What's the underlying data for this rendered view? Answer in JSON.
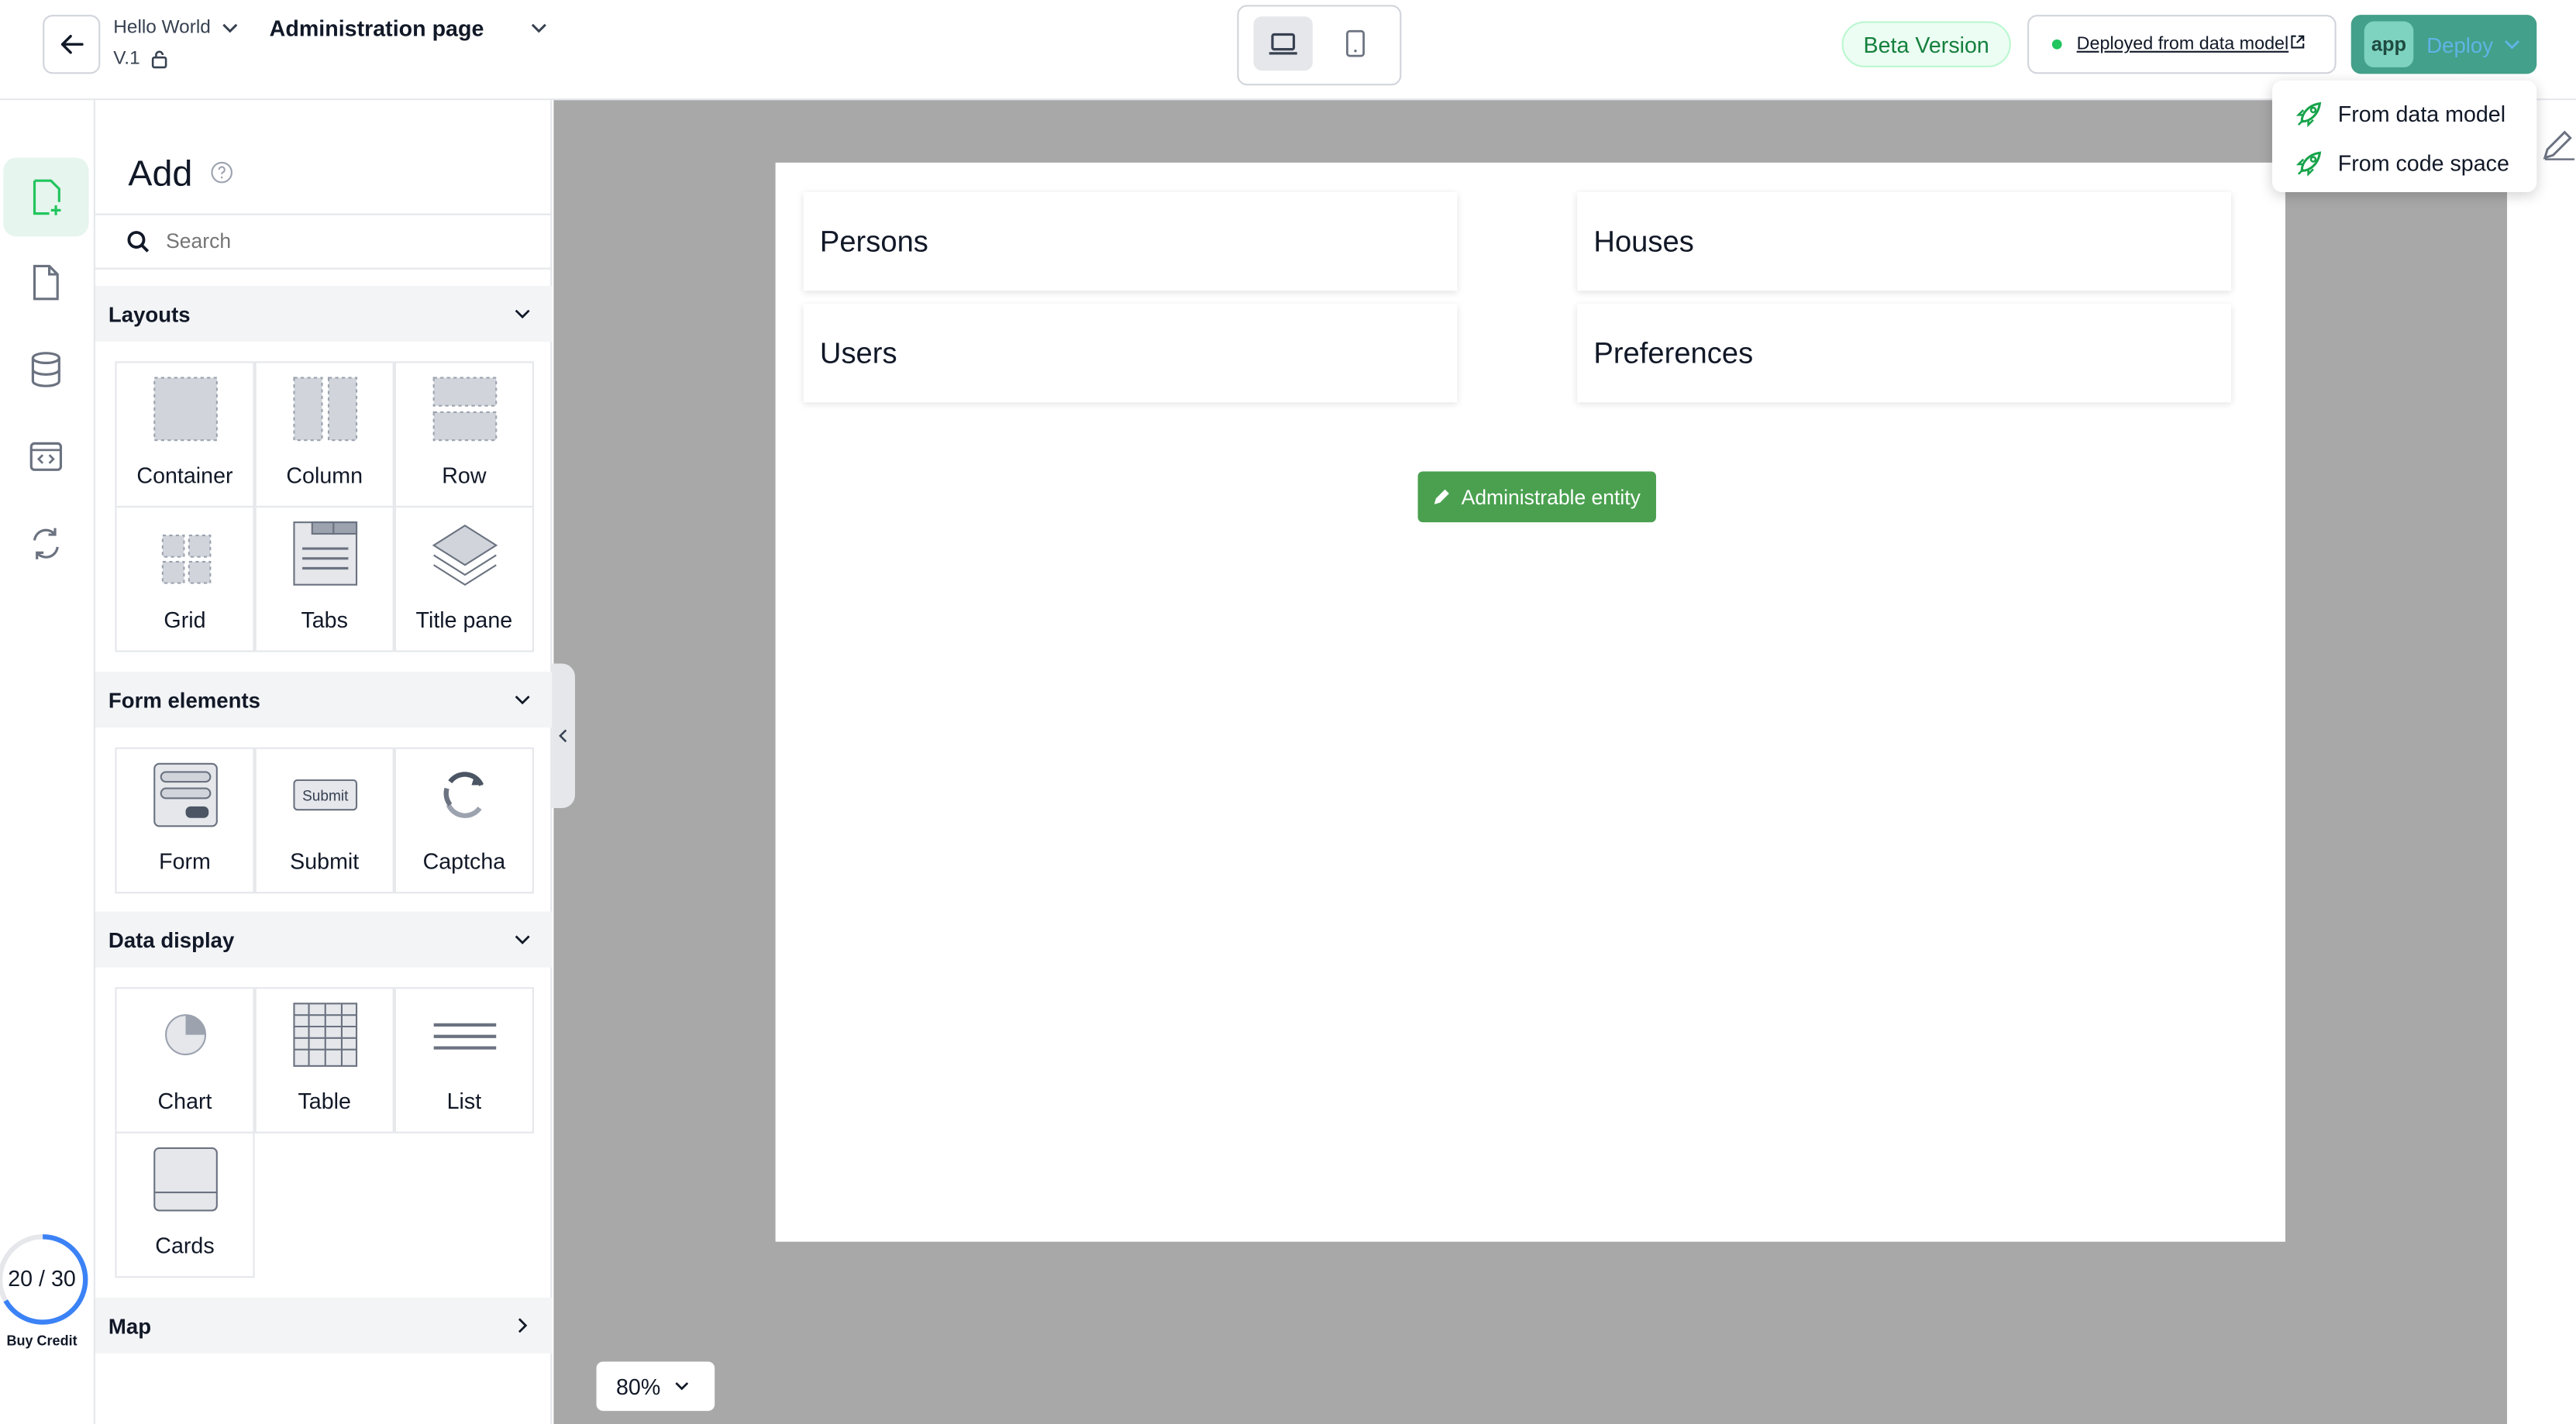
{
  "header": {
    "project_name": "Hello World",
    "version": "V.1",
    "page_title": "Administration page",
    "beta_badge": "Beta Version",
    "deployed_link": "Deployed from data model",
    "deploy_app_icon": "app",
    "deploy_label": "Deploy",
    "device_modes": [
      "desktop-icon",
      "mobile-icon"
    ]
  },
  "deploy_menu": {
    "items": [
      "From data model",
      "From code space"
    ]
  },
  "rail": {
    "items": [
      "add-page-icon",
      "file-icon",
      "database-icon",
      "code-icon",
      "sync-icon"
    ],
    "credit": {
      "used": 20,
      "total": 30,
      "label": "20 / 30",
      "buy_label": "Buy Credit"
    }
  },
  "panel": {
    "title": "Add",
    "search_placeholder": "Search",
    "sections": [
      {
        "title": "Layouts",
        "expanded": true,
        "items": [
          "Container",
          "Column",
          "Row",
          "Grid",
          "Tabs",
          "Title pane"
        ]
      },
      {
        "title": "Form elements",
        "expanded": true,
        "items": [
          "Form",
          "Submit",
          "Captcha"
        ]
      },
      {
        "title": "Data display",
        "expanded": true,
        "items": [
          "Chart",
          "Table",
          "List",
          "Cards"
        ]
      },
      {
        "title": "Map",
        "expanded": false,
        "items": []
      }
    ],
    "submit_icon_text": "Submit"
  },
  "canvas": {
    "cards": [
      "Persons",
      "Houses",
      "Users",
      "Preferences"
    ],
    "admin_button": "Administrable entity",
    "zoom": "80%"
  },
  "colors": {
    "accent": "#4aa04f",
    "deploy": "#43a08a",
    "canvas_bg": "#a8a8a8",
    "credit_ring": "#3b82f6"
  }
}
